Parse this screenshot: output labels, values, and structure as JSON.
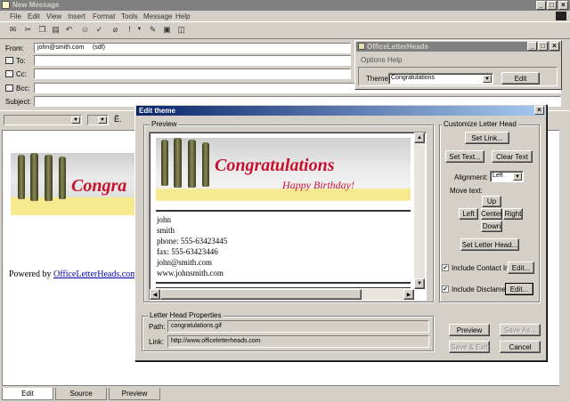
{
  "window": {
    "title": "New Message"
  },
  "menu": [
    "File",
    "Edit",
    "View",
    "Insert",
    "Format",
    "Tools",
    "Message",
    "Help"
  ],
  "toolbar_icons": [
    "send-icon",
    "cut-icon",
    "copy-icon",
    "paste-icon",
    "undo-icon",
    "check-names-icon",
    "spelling-icon",
    "attach-icon",
    "priority-icon",
    "sign-icon",
    "encrypt-icon",
    "offline-icon"
  ],
  "headers": {
    "from_label": "From:",
    "from_value": "john@smith.com     (sdf)",
    "to_label": "To:",
    "cc_label": "Cc:",
    "bcc_label": "Bcc:",
    "subject_label": "Subject:"
  },
  "body": {
    "powered_by": "Powered by ",
    "powered_link": "OfficeLetterHeads.com",
    "banner_text": "Congra"
  },
  "tabs": [
    "Edit",
    "Source",
    "Preview"
  ],
  "olh": {
    "title": "OfficeLetterHeads",
    "menu": [
      "Options",
      "Help"
    ],
    "theme_label": "Theme:",
    "theme_value": "Congratulations",
    "edit_button": "Edit"
  },
  "dialog": {
    "title": "Edit theme",
    "preview_group": "Preview",
    "banner_title": "Congratulations",
    "banner_subtitle": "Happy Birthday!",
    "contact_lines": [
      "john",
      "smith",
      "phone: 555-63423445",
      "fax: 555-63423446",
      "john@smith.com",
      "www.johnsmith.com"
    ],
    "props_group": "Letter Head Properties",
    "path_label": "Path:",
    "path_value": "congratulations.gif",
    "link_label": "Link:",
    "link_value": "http://www.officeletterheads.com",
    "customize_group": "Customize Letter Head",
    "set_link": "Set Link...",
    "set_text": "Set Text...",
    "clear_text": "Clear Text",
    "alignment_label": "Alignment:",
    "alignment_value": "Left",
    "move_text_label": "Move text:",
    "up": "Up",
    "left": "Left",
    "center": "Center",
    "right": "Right",
    "down": "Down",
    "set_letter_head": "Set Letter Head...",
    "include_contact": "Include Contact Info",
    "include_contact_checked": true,
    "include_disclaimer": "Include Disclamer",
    "include_disclaimer_checked": true,
    "edit_small": "Edit...",
    "preview_btn": "Preview",
    "save_as": "Save As...",
    "save_exit": "Save & Exit",
    "cancel": "Cancel"
  },
  "colors": {
    "titlebar_active": "#0a246a",
    "titlebar_inactive": "#808080",
    "banner_red": "#c8102e",
    "banner_yellow": "#f7e98e",
    "link": "#0000aa"
  }
}
